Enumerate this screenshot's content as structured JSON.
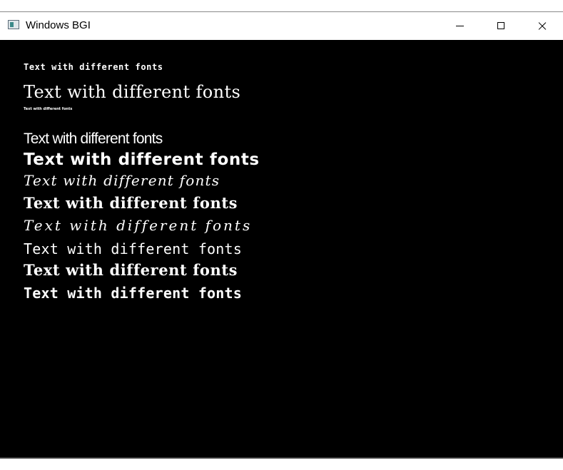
{
  "window": {
    "title": "Windows BGI",
    "icon": "window-app-icon"
  },
  "titlebar_buttons": {
    "minimize_icon": "minimize-icon",
    "maximize_icon": "maximize-icon",
    "close_icon": "close-icon"
  },
  "canvas": {
    "background": "#000000",
    "text_color": "#ffffff",
    "lines": [
      "Text with different fonts",
      "Text with different fonts",
      "Text with different fonts",
      "Text with different fonts",
      "Text with different fonts",
      "Text with different fonts",
      "Text with different fonts",
      "Text with different fonts",
      "Text with different fonts",
      "Text with different fonts",
      "Text with different fonts"
    ]
  }
}
